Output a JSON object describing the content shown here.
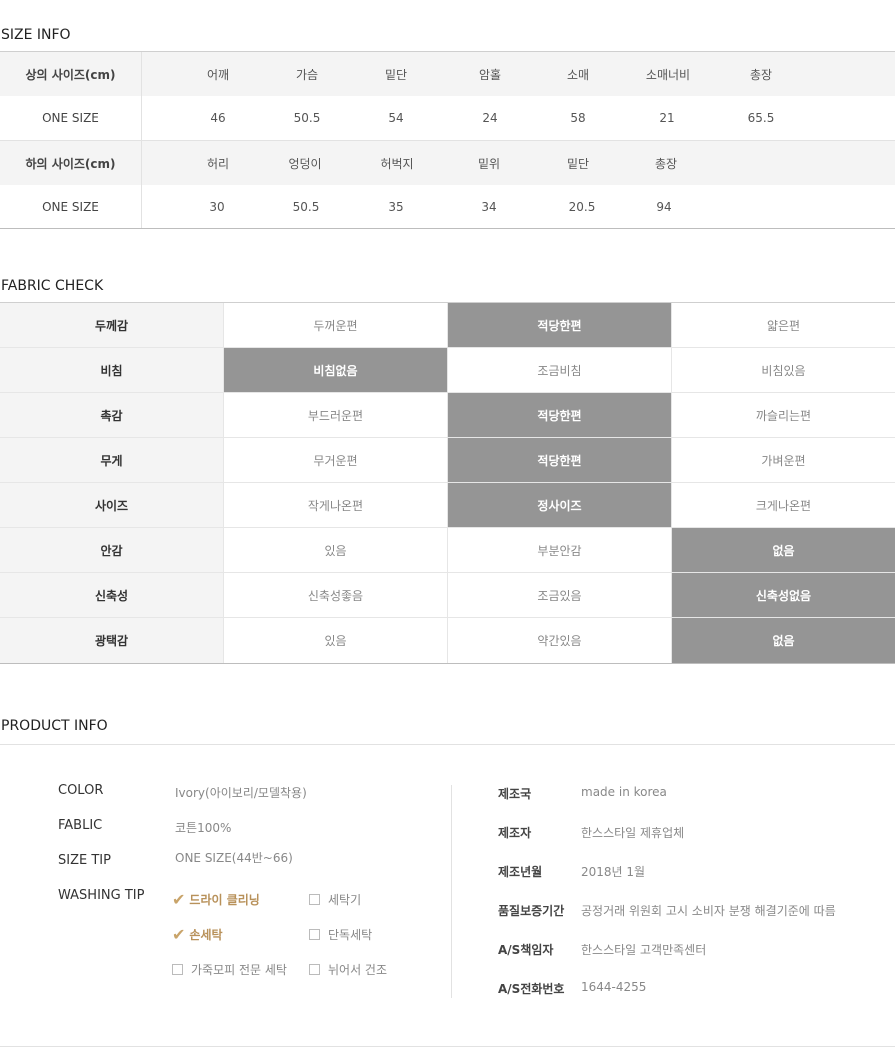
{
  "size_info": {
    "title": "SIZE INFO",
    "top": {
      "label": "상의 사이즈(cm)",
      "headers": [
        "어깨",
        "가슴",
        "밑단",
        "암홀",
        "소매",
        "소매너비",
        "총장"
      ],
      "row_label": "ONE SIZE",
      "values": [
        "46",
        "50.5",
        "54",
        "24",
        "58",
        "21",
        "65.5"
      ]
    },
    "bottom": {
      "label": "하의 사이즈(cm)",
      "headers": [
        "허리",
        "엉덩이",
        "허벅지",
        "밑위",
        "밑단",
        "총장"
      ],
      "row_label": "ONE SIZE",
      "values": [
        "30",
        "50.5",
        "35",
        "34",
        "20.5",
        "94"
      ]
    }
  },
  "fabric_check": {
    "title": "FABRIC CHECK",
    "rows": [
      {
        "label": "두께감",
        "options": [
          "두꺼운편",
          "적당한편",
          "얇은편"
        ],
        "selected": 1
      },
      {
        "label": "비침",
        "options": [
          "비침없음",
          "조금비침",
          "비침있음"
        ],
        "selected": 0
      },
      {
        "label": "촉감",
        "options": [
          "부드러운편",
          "적당한편",
          "까슬리는편"
        ],
        "selected": 1
      },
      {
        "label": "무게",
        "options": [
          "무거운편",
          "적당한편",
          "가벼운편"
        ],
        "selected": 1
      },
      {
        "label": "사이즈",
        "options": [
          "작게나온편",
          "정사이즈",
          "크게나온편"
        ],
        "selected": 1
      },
      {
        "label": "안감",
        "options": [
          "있음",
          "부분안감",
          "없음"
        ],
        "selected": 2
      },
      {
        "label": "신축성",
        "options": [
          "신축성좋음",
          "조금있음",
          "신축성없음"
        ],
        "selected": 2
      },
      {
        "label": "광택감",
        "options": [
          "있음",
          "약간있음",
          "없음"
        ],
        "selected": 2
      }
    ],
    "selected_color": "#959595"
  },
  "product_info": {
    "title": "PRODUCT INFO",
    "left": {
      "color_label": "COLOR",
      "color_value": "Ivory(아이보리/모델착용)",
      "fablic_label": "FABLIC",
      "fablic_value": "코튼100%",
      "size_tip_label": "SIZE TIP",
      "size_tip_value": "ONE SIZE(44반~66)",
      "washing_label": "WASHING TIP",
      "washing": [
        {
          "label": "드라이 클리닝",
          "checked": true
        },
        {
          "label": "세탁기",
          "checked": false
        },
        {
          "label": "손세탁",
          "checked": true
        },
        {
          "label": "단독세탁",
          "checked": false
        },
        {
          "label": "가죽모피 전문 세탁",
          "checked": false
        },
        {
          "label": "뉘어서 건조",
          "checked": false
        }
      ]
    },
    "right": [
      {
        "label": "제조국",
        "value": "made in korea"
      },
      {
        "label": "제조자",
        "value": "한스스타일 제휴업체"
      },
      {
        "label": "제조년월",
        "value": "2018년 1월"
      },
      {
        "label": "품질보증기간",
        "value": "공정거래 위원회 고시 소비자 분쟁 해결기준에 따름"
      },
      {
        "label": "A/S책임자",
        "value": "한스스타일 고객만족센터"
      },
      {
        "label": "A/S전화번호",
        "value": "1644-4255"
      }
    ],
    "accent_color": "#c9a46a"
  }
}
